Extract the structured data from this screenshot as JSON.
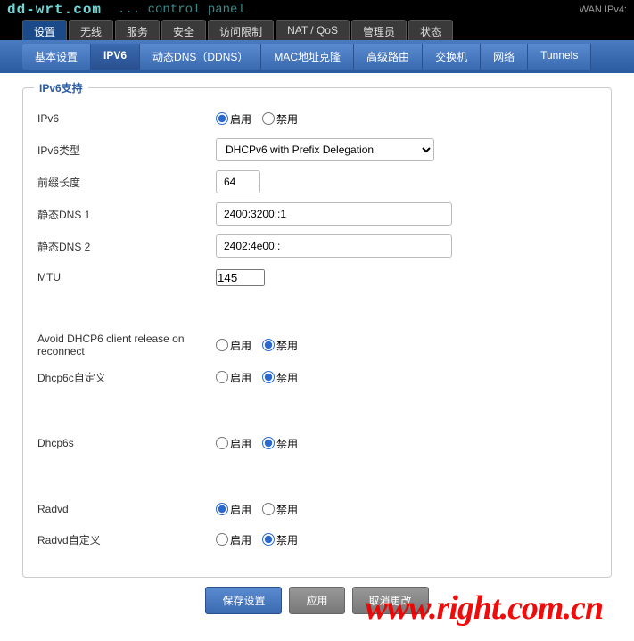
{
  "header": {
    "logo": "dd-wrt.com",
    "subtitle": "... control panel",
    "wan": "WAN IPv4:"
  },
  "tabs1": [
    "设置",
    "无线",
    "服务",
    "安全",
    "访问限制",
    "NAT / QoS",
    "管理员",
    "状态"
  ],
  "tabs1_active": 0,
  "tabs2": [
    "基本设置",
    "IPV6",
    "动态DNS（DDNS）",
    "MAC地址克隆",
    "高级路由",
    "交换机",
    "网络",
    "Tunnels"
  ],
  "tabs2_active": 1,
  "legend": "IPv6支持",
  "labels": {
    "enable": "启用",
    "disable": "禁用",
    "ipv6": "IPv6",
    "ipv6_type": "IPv6类型",
    "prefix_len": "前缀长度",
    "dns1": "静态DNS 1",
    "dns2": "静态DNS 2",
    "mtu": "MTU",
    "avoid_release": "Avoid DHCP6 client release on reconnect",
    "dhcp6c_custom": "Dhcp6c自定义",
    "dhcp6s": "Dhcp6s",
    "radvd": "Radvd",
    "radvd_custom": "Radvd自定义"
  },
  "values": {
    "ipv6_type": "DHCPv6 with Prefix Delegation",
    "prefix_len": "64",
    "dns1": "2400:3200::1",
    "dns2": "2402:4e00::",
    "mtu": "145"
  },
  "radios": {
    "ipv6": "enable",
    "avoid_release": "disable",
    "dhcp6c_custom": "disable",
    "dhcp6s": "disable",
    "radvd": "enable",
    "radvd_custom": "disable"
  },
  "buttons": {
    "save": "保存设置",
    "apply": "应用",
    "cancel": "取消更改"
  },
  "watermark": "www.right.com.cn"
}
